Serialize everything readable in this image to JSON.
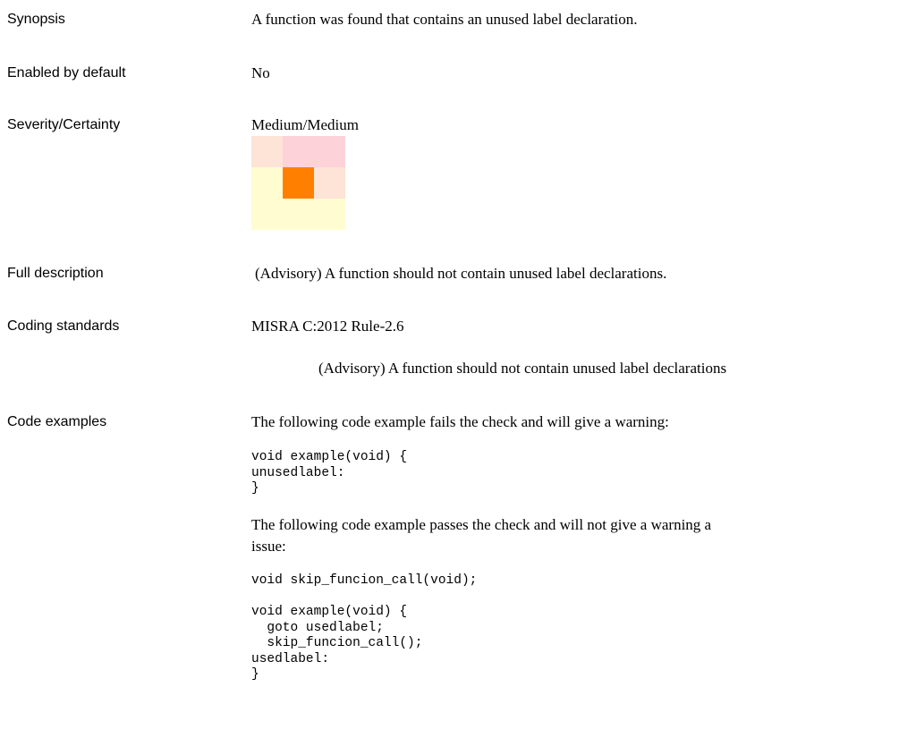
{
  "labels": {
    "synopsis": "Synopsis",
    "enabled": "Enabled by default",
    "severity": "Severity/Certainty",
    "full_description": "Full description",
    "coding_standards": "Coding standards",
    "code_examples": "Code examples"
  },
  "synopsis": "A function was found that contains an unused label declaration.",
  "enabled_by_default": "No",
  "severity_certainty": "Medium/Medium",
  "severity_matrix": {
    "colors": [
      [
        "#fde4d6",
        "#fdd2d8",
        "#fdd2d8"
      ],
      [
        "#fffcd2",
        "#ff8000",
        "#fde4d6"
      ],
      [
        "#fffcd2",
        "#fffcd2",
        "#fffcd2"
      ]
    ],
    "highlighted": {
      "row": 1,
      "col": 1
    }
  },
  "full_description": "(Advisory) A function should not contain unused label declarations.",
  "coding_standards": {
    "standard": "MISRA C:2012 Rule-2.6",
    "rule_text": "(Advisory) A function should not contain unused label declarations"
  },
  "code_examples": {
    "fail_intro": "The following code example fails the check and will give a warning:",
    "fail_code": "void example(void) {\nunusedlabel:\n}",
    "pass_intro_line1": "The following code example passes the check and will not give a warning a",
    "pass_intro_line2": "issue:",
    "pass_code": "void skip_funcion_call(void);\n\nvoid example(void) {\n  goto usedlabel;\n  skip_funcion_call();\nusedlabel:\n}"
  }
}
